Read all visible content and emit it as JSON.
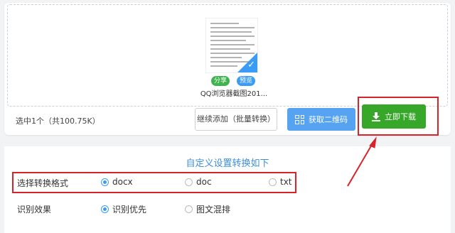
{
  "file": {
    "name": "QQ浏览器截图201...",
    "share_tag": "分享",
    "preview_tag": "预览"
  },
  "toolbar": {
    "selected_info": "选中1个（共100.75K）",
    "add_label": "继续添加（批量转换）",
    "qr_label": "获取二维码",
    "download_label": "立即下载"
  },
  "settings": {
    "title": "自定义设置转换如下",
    "format": {
      "label": "选择转换格式",
      "options": [
        "docx",
        "doc",
        "txt"
      ],
      "selected": "docx"
    },
    "recognition": {
      "label": "识别效果",
      "options": [
        "识别优先",
        "图文混排"
      ],
      "selected": "识别优先"
    }
  },
  "colors": {
    "accent_blue": "#3b9cf6",
    "download_green": "#37a72a",
    "annotation_red": "#d8232a"
  },
  "icons": {
    "qr": "qr-code-icon",
    "download": "download-icon",
    "check": "check-icon"
  }
}
